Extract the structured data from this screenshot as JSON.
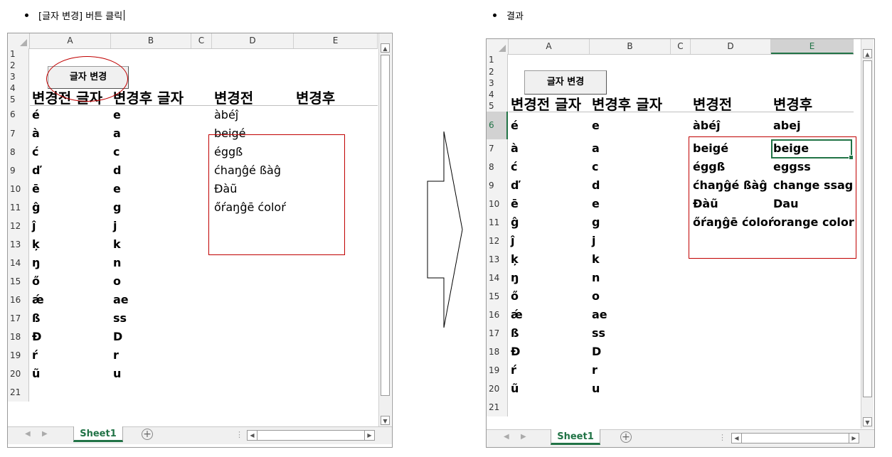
{
  "left_caption": "[글자 변경] 버튼 클릭",
  "right_caption": "결과",
  "columns": [
    "A",
    "B",
    "C",
    "D",
    "E"
  ],
  "rows": [
    "1",
    "2",
    "3",
    "4",
    "5",
    "6",
    "7",
    "8",
    "9",
    "10",
    "11",
    "12",
    "13",
    "14",
    "15",
    "16",
    "17",
    "18",
    "19",
    "20",
    "21"
  ],
  "button_label": "글자 변경",
  "headers": {
    "a": "변경전 글자",
    "b": "변경후 글자",
    "d": "변경전",
    "e": "변경후"
  },
  "col_a": [
    "é",
    "à",
    "ć",
    "ď",
    "ē",
    "ĝ",
    "ĵ",
    "ķ",
    "ŋ",
    "ő",
    "ǽ",
    "ß",
    "Đ",
    "ŕ",
    "ũ"
  ],
  "col_b": [
    "e",
    "a",
    "c",
    "d",
    "e",
    "g",
    "j",
    "k",
    "n",
    "o",
    "ae",
    "ss",
    "D",
    "r",
    "u"
  ],
  "col_d": [
    "àbéĵ",
    "beigé",
    "éggß",
    "ćhaŋĝé ßàĝ",
    "Đàũ",
    "őŕaŋĝē ćoloŕ"
  ],
  "col_e": [
    "abej",
    "beige",
    "eggss",
    "change ssag",
    "Dau",
    "orange color"
  ],
  "sheet_tab": "Sheet1",
  "add_sheet": "+",
  "colors": {
    "accent": "#217346",
    "annotation": "#c00000"
  }
}
